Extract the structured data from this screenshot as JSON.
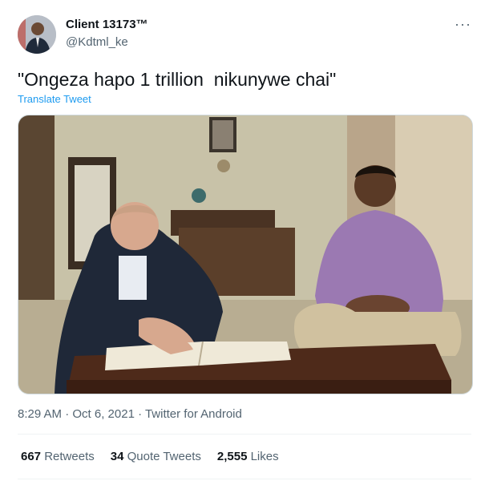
{
  "user": {
    "name": "Client 13173™",
    "handle": "@Kdtml_ke"
  },
  "tweet": {
    "text": "\"Ongeza hapo 1 trillion  nikunywe chai\"",
    "translate_label": "Translate Tweet",
    "media_icon": "photo",
    "more_icon": "more-horizontal-icon",
    "more_label": "···"
  },
  "meta": {
    "timestamp": "8:29 AM · Oct 6, 2021 · Twitter for Android"
  },
  "stats": [
    {
      "value": "667",
      "label": "Retweets"
    },
    {
      "value": "34",
      "label": "Quote Tweets"
    },
    {
      "value": "2,555",
      "label": "Likes"
    }
  ],
  "colors": {
    "link": "#1d9bf0",
    "secondary": "#536471",
    "primary_text": "#0f1419"
  }
}
